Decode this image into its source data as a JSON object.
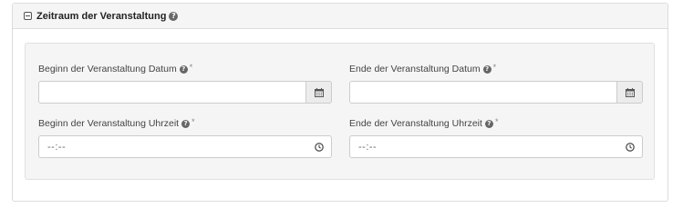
{
  "panel": {
    "title": "Zeitraum der Veranstaltung",
    "help": "?"
  },
  "fields": {
    "start_date": {
      "label": "Beginn der Veranstaltung Datum",
      "required": "*",
      "value": "",
      "addon_icon": "calendar-icon"
    },
    "end_date": {
      "label": "Ende der Veranstaltung Datum",
      "required": "*",
      "value": "",
      "addon_icon": "calendar-icon"
    },
    "start_time": {
      "label": "Beginn der Veranstaltung Uhrzeit",
      "required": "*",
      "value": "--:--",
      "icon": "clock-icon"
    },
    "end_time": {
      "label": "Ende der Veranstaltung Uhrzeit",
      "required": "*",
      "value": "--:--",
      "icon": "clock-icon"
    }
  },
  "help_glyph": "?"
}
